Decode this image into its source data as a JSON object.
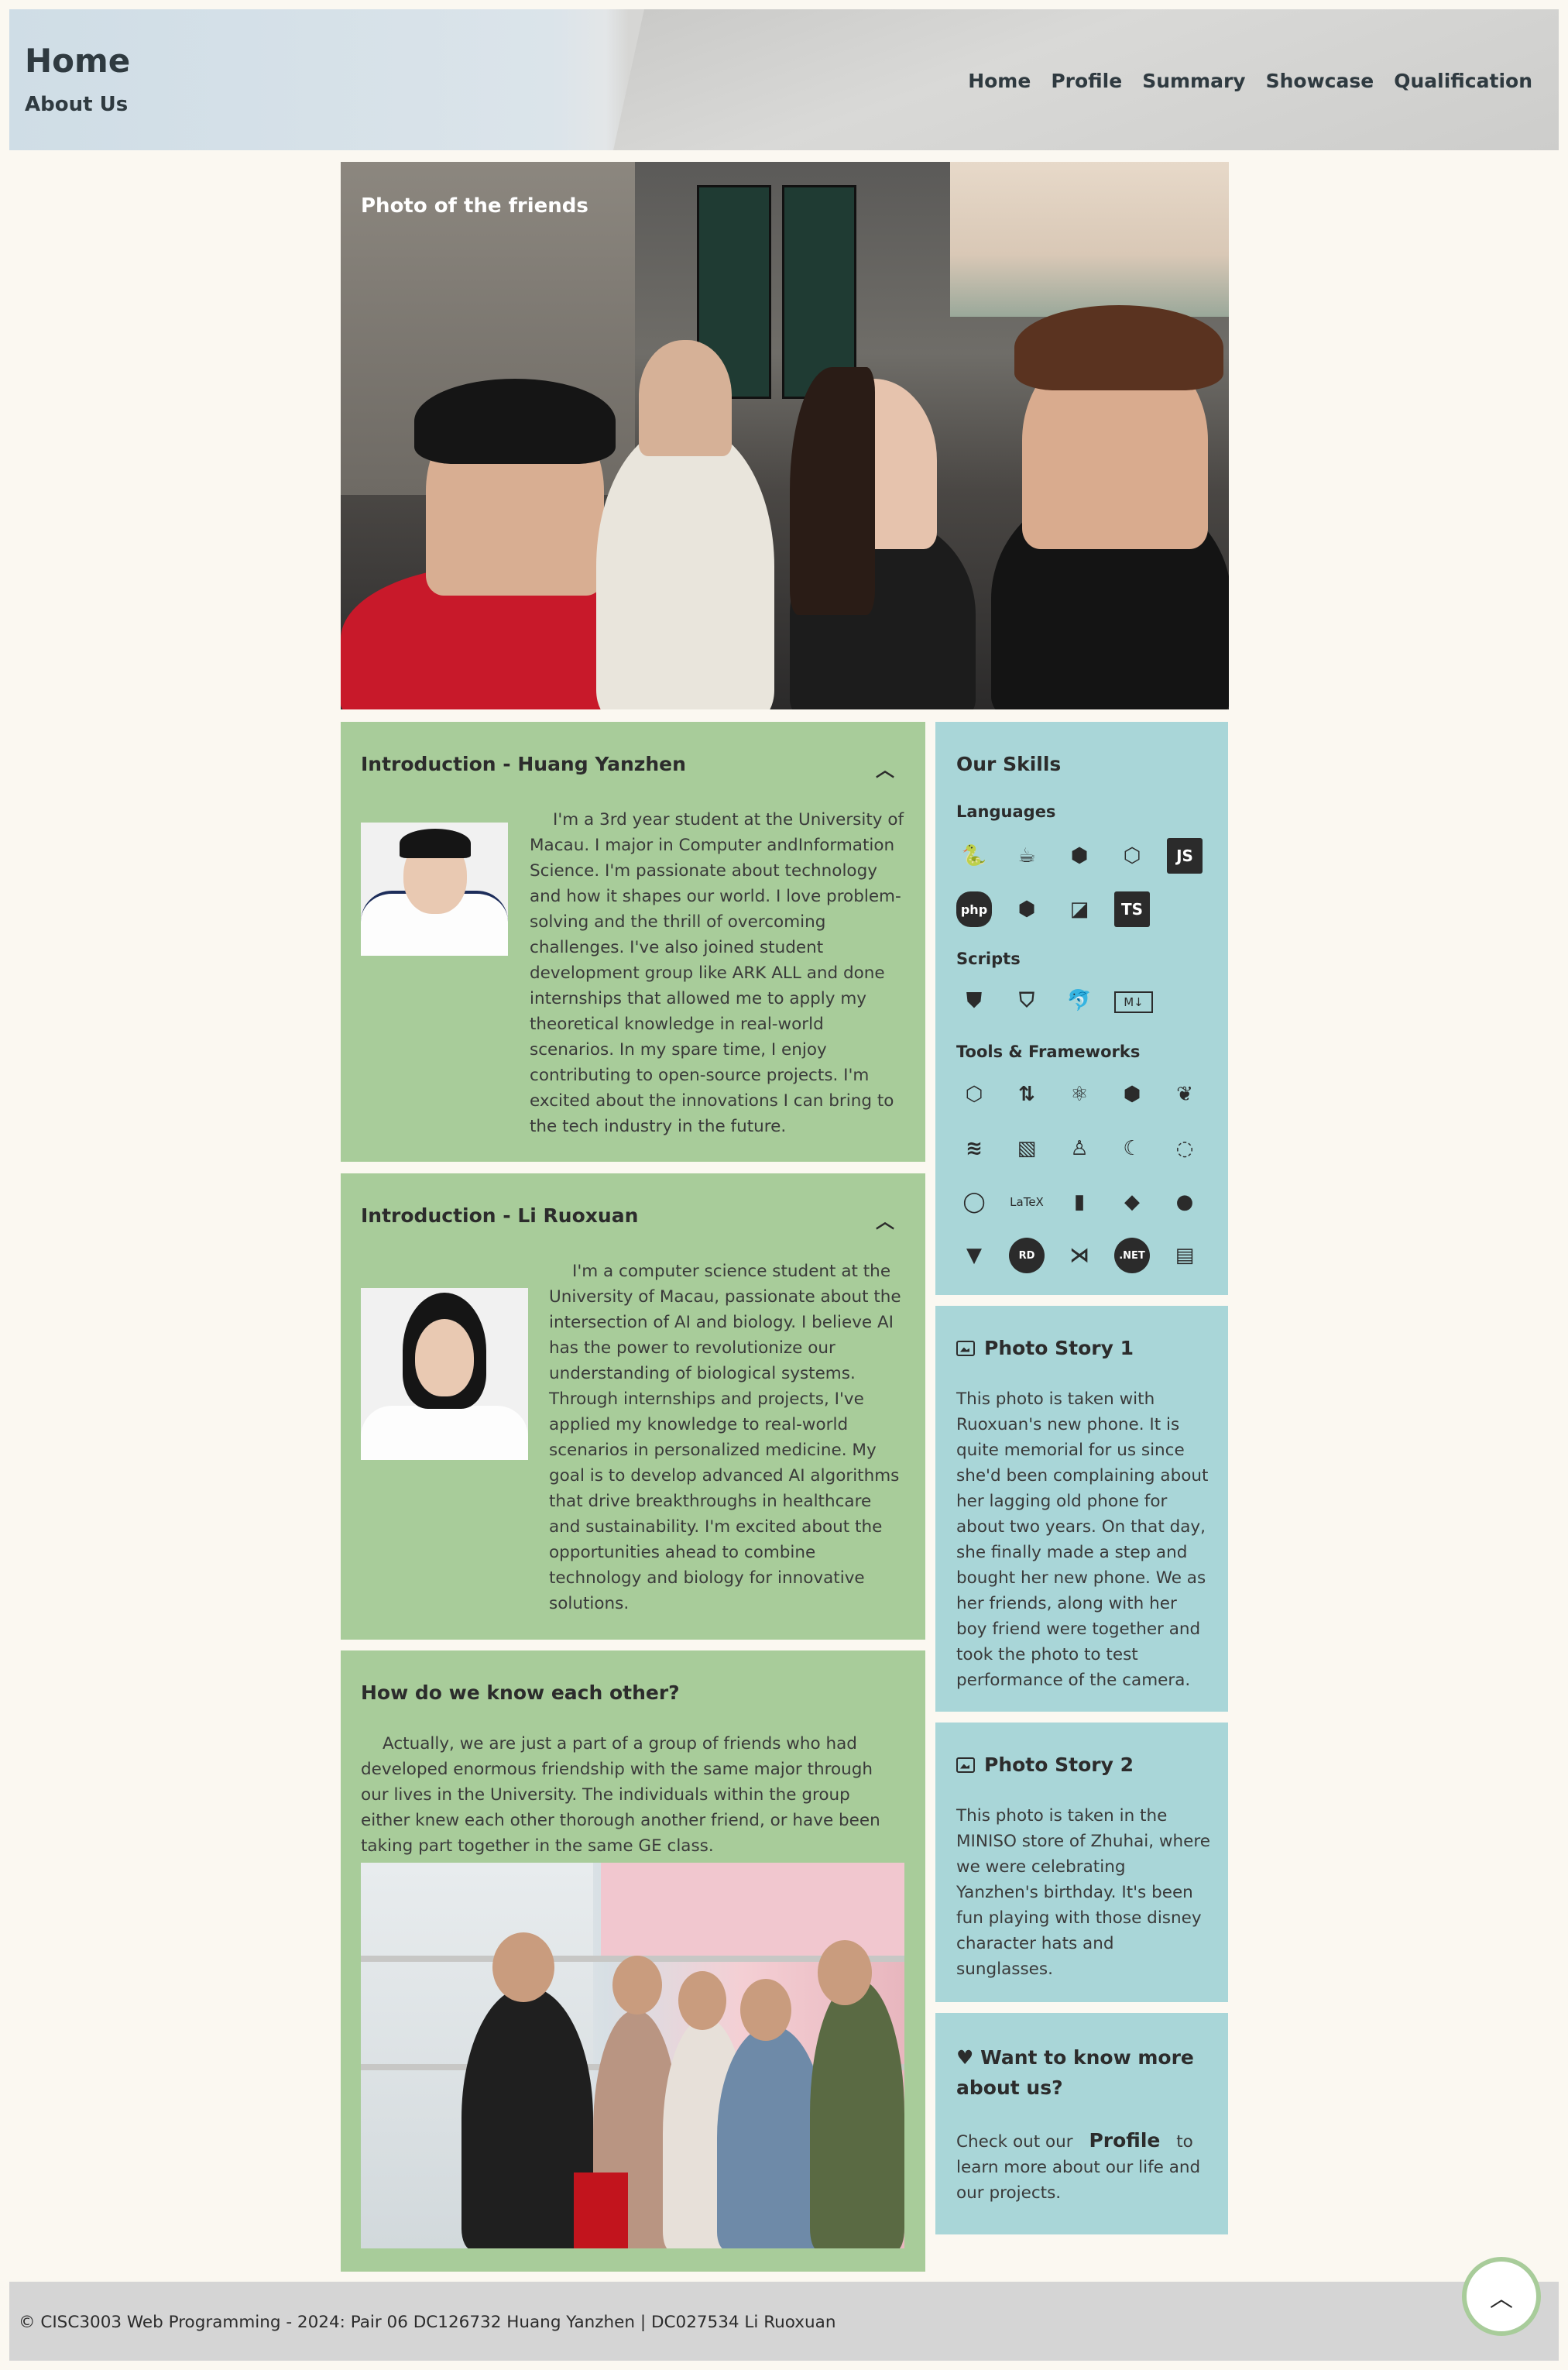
{
  "header": {
    "title": "Home",
    "subtitle": "About Us",
    "nav": [
      "Home",
      "Profile",
      "Summary",
      "Showcase",
      "Qualification"
    ]
  },
  "hero": {
    "caption": "Photo of the friends"
  },
  "intro1": {
    "title": "Introduction - Huang Yanzhen",
    "text": "I'm a 3rd year student at the University of Macau. I major in Computer andInformation Science. I'm passionate about technology and how it shapes our world. I love problem-solving and the thrill of overcoming challenges. I've also joined student development group like ARK ALL and done internships that allowed me to apply my theoretical knowledge in real-world scenarios. In my spare time, I enjoy contributing to open-source projects. I'm excited about the innovations I can bring to the tech industry in the future."
  },
  "intro2": {
    "title": "Introduction - Li Ruoxuan",
    "text": "I'm a computer science student at the University of Macau, passionate about the intersection of AI and biology. I believe AI has the power to revolutionize our understanding of biological systems. Through internships and projects, I've applied my knowledge to real-world scenarios in personalized medicine. My goal is to develop advanced AI algorithms that drive breakthroughs in healthcare and sustainability. I'm excited about the opportunities ahead to combine technology and biology for innovative solutions."
  },
  "know": {
    "title": "How do we know each other?",
    "text": "Actually, we are just a part of a group of friends who had developed enormous friendship with the same major through our lives in the University. The individuals within the group either knew each other thorough another friend, or have been taking part together in the same GE class."
  },
  "skills": {
    "title": "Our Skills",
    "languages_label": "Languages",
    "scripts_label": "Scripts",
    "tools_label": "Tools & Frameworks",
    "languages": [
      "python-icon",
      "java-icon",
      "csharp-icon",
      "c-icon",
      "javascript-icon",
      "php-icon",
      "cpp-icon",
      "swift-icon",
      "typescript-icon"
    ],
    "scripts": [
      "html5-icon",
      "css3-icon",
      "mysql-icon",
      "markdown-icon"
    ],
    "tools": [
      "unity-icon",
      "git-compare-icon",
      "react-icon",
      "hexagon-icon",
      "leaf-icon",
      "layers-icon",
      "vue-icon",
      "linux-icon",
      "moon-icon",
      "ring-icon",
      "loader-icon",
      "latex-icon",
      "phone-icon",
      "git-icon",
      "github-icon",
      "gitlab-icon",
      "rd-icon",
      "vscode-icon",
      "dotnet-icon",
      "illustrator-icon"
    ],
    "js": "JS",
    "php": "php",
    "ts": "TS",
    "md": "M↓",
    "latex": "LaTeX",
    "rd": "RD",
    "net": ".NET"
  },
  "story1": {
    "title": "Photo Story 1",
    "text": "This photo is taken with Ruoxuan's new phone. It is quite memorial for us since she'd been complaining about her lagging old phone for about two years. On that day, she finally made a step and bought her new phone. We as her friends, along with her boy friend were together and took the photo to test performance of the camera."
  },
  "story2": {
    "title": "Photo Story 2",
    "text": "This photo is taken in the MINISO store of Zhuhai, where we were celebrating Yanzhen's birthday. It's been fun playing with those disney character hats and sunglasses."
  },
  "more": {
    "title": "Want to know more about us?",
    "pre": "Check out our",
    "link": "Profile",
    "post": "to learn more about our life and our projects."
  },
  "footer": {
    "text": "© CISC3003 Web Programming - 2024: Pair 06 DC126732 Huang Yanzhen | DC027534 Li Ruoxuan"
  },
  "colors": {
    "green_card": "#a8cc9a",
    "teal_card": "#a9d6d8",
    "page_bg": "#fbf8f1",
    "footer_bg": "#d5d5d5"
  }
}
